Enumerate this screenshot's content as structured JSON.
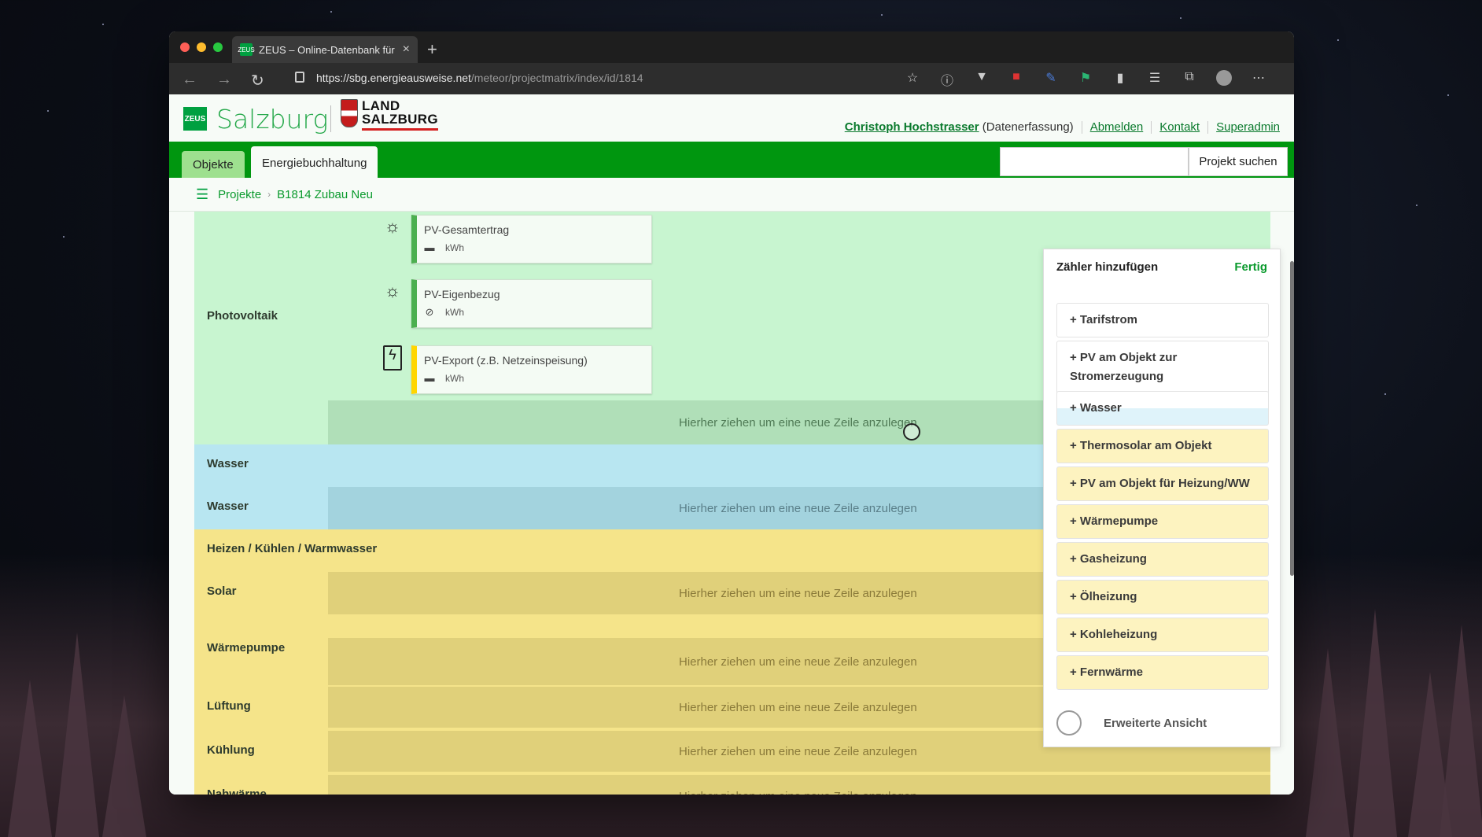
{
  "browser": {
    "tab_title": "ZEUS – Online-Datenbank für E",
    "tab_favicon": "ZEUS",
    "url_host": "https://sbg.energieausweise.net",
    "url_path": "/meteor/projectmatrix/index/id/1814"
  },
  "header": {
    "logo_badge": "ZEUS",
    "logo_text": "Salzburg",
    "land_line1": "LAND",
    "land_line2": "SALZBURG",
    "user_name": "Christoph Hochstrasser",
    "user_role": "(Datenerfassung)",
    "links": [
      "Abmelden",
      "Kontakt",
      "Superadmin"
    ]
  },
  "nav": {
    "tabs": [
      "Objekte",
      "Energiebuchhaltung"
    ],
    "search_placeholder": "",
    "search_button": "Projekt suchen"
  },
  "breadcrumb": [
    "Projekte",
    "B1814 Zubau Neu"
  ],
  "matrix": {
    "drop_text": "Hierher ziehen um eine neue Zeile anzulegen",
    "photovoltaik_label": "Photovoltaik",
    "meters": [
      {
        "name": "PV-Gesamtertrag",
        "unit": "kWh",
        "status_icon": "minus-icon"
      },
      {
        "name": "PV-Eigenbezug",
        "unit": "kWh",
        "status_icon": "blocked-icon"
      },
      {
        "name": "PV-Export (z.B. Netzeinspeisung)",
        "unit": "kWh",
        "status_icon": "minus-icon"
      }
    ],
    "rows": [
      {
        "label": "Wasser"
      },
      {
        "label": "Wasser"
      },
      {
        "label": "Heizen / Kühlen / Warmwasser"
      },
      {
        "label": "Solar"
      },
      {
        "label": "Wärmepumpe"
      },
      {
        "label": "Lüftung"
      },
      {
        "label": "Kühlung"
      },
      {
        "label": "Nahwärme"
      }
    ]
  },
  "panel": {
    "title": "Zähler hinzufügen",
    "done": "Fertig",
    "items": [
      "+ Tarifstrom",
      "+ PV am Objekt zur Stromerzeugung",
      "+ Wasser",
      "+ Thermosolar am Objekt",
      "+ PV am Objekt für Heizung/WW",
      "+ Wärmepumpe",
      "+ Gasheizung",
      "+ Ölheizung",
      "+ Kohleheizung",
      "+ Fernwärme"
    ],
    "toggle_label": "Erweiterte Ansicht"
  },
  "colors": {
    "brand_green": "#00960f",
    "pv_bg": "#c8f5d0",
    "water_bg": "#b8e6f1",
    "heat_bg": "#f5e48a"
  }
}
